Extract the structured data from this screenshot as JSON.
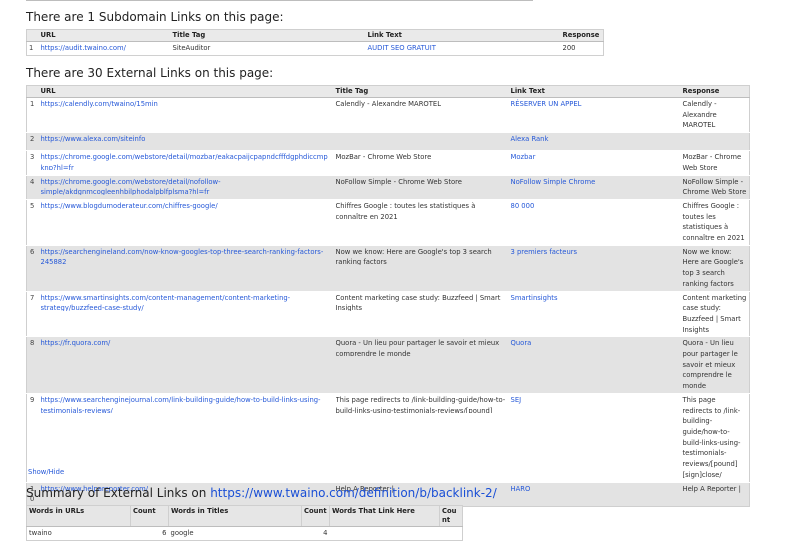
{
  "subdomain": {
    "heading": "There are 1 Subdomain Links on this page:",
    "columns": [
      "URL",
      "Title Tag",
      "Link Text",
      "Response"
    ],
    "rows": [
      {
        "n": "1",
        "url": "https://audit.twaino.com/",
        "title": "SiteAuditor",
        "text": "AUDIT SEO GRATUIT",
        "response": "200"
      }
    ]
  },
  "external": {
    "heading": "There are 30 External Links on this page:",
    "columns": [
      "URL",
      "Title Tag",
      "Link Text",
      "Response"
    ],
    "rows": [
      {
        "n": "1",
        "url": "https://calendly.com/twaino/15min",
        "title": "Calendly - Alexandre MAROTEL",
        "text": "RÉSERVER UN APPEL",
        "response": "Calendly - Alexandre MAROTEL"
      },
      {
        "n": "2",
        "url": "https://www.alexa.com/siteinfo",
        "title": "",
        "text": "Alexa Rank",
        "response": ""
      },
      {
        "n": "3",
        "url": "https://chrome.google.com/webstore/detail/mozbar/eakacpaijcpapndcfffdgphdiccmpknp?hl=fr",
        "title": "MozBar - Chrome Web Store",
        "text": "Mozbar",
        "response": "MozBar - Chrome Web Store"
      },
      {
        "n": "4",
        "url": "https://chrome.google.com/webstore/detail/nofollow-simple/akdgnmcogleenhbilphodalpblfplsma?hl=fr",
        "title": "NoFollow Simple - Chrome Web Store",
        "text": "NoFollow Simple Chrome",
        "response": "NoFollow Simple - Chrome Web Store"
      },
      {
        "n": "5",
        "url": "https://www.blogdumoderateur.com/chiffres-google/",
        "title": "Chiffres Google : toutes les statistiques à connaître en 2021",
        "text": "80 000",
        "response": "Chiffres Google : toutes les statistiques à connaître en 2021"
      },
      {
        "n": "6",
        "url": "https://searchengineland.com/now-know-googles-top-three-search-ranking-factors-245882",
        "title": "Now we know: Here are Google's top 3 search ranking factors",
        "text": "3 premiers facteurs",
        "response": "Now we know: Here are Google's top 3 search ranking factors"
      },
      {
        "n": "7",
        "url": "https://www.smartinsights.com/content-management/content-marketing-strategy/buzzfeed-case-study/",
        "title": "Content marketing case study: Buzzfeed  | Smart Insights",
        "text": "Smartinsights",
        "response": "Content marketing case study: Buzzfeed  | Smart Insights"
      },
      {
        "n": "8",
        "url": "https://fr.quora.com/",
        "title": "Quora - Un lieu pour partager le savoir et mieux comprendre le monde",
        "text": "Quora",
        "response": "Quora - Un lieu pour partager le savoir et mieux comprendre le monde"
      },
      {
        "n": "9",
        "url": "https://www.searchenginejournal.com/link-building-guide/how-to-build-links-using-testimonials-reviews/",
        "title": "This page redirects to /link-building-guide/how-to-build-links-using-testimonials-reviews/[pound]",
        "text": "SEJ",
        "response": "This page redirects to /link-building-guide/how-to-build-links-using-testimonials-reviews/[pound][sign]close/"
      },
      {
        "n": "10",
        "url": "https://www.helpareporter.com/",
        "title": "Help A Reporter |",
        "text": "HARO",
        "response": "Help A Reporter |"
      }
    ],
    "show_hide": "Show/Hide"
  },
  "summary": {
    "heading_prefix": "Summary of External Links on ",
    "heading_url": "https://www.twaino.com/definition/b/backlink-2/",
    "columns": [
      "Words in URLs",
      "Count",
      "Words in Titles",
      "Count",
      "Words That Link Here",
      "Count"
    ],
    "rows": [
      {
        "url_word": "twaino",
        "url_count": "6",
        "title_word": "google",
        "title_count": "4",
        "link_word": "",
        "link_count": ""
      }
    ]
  }
}
